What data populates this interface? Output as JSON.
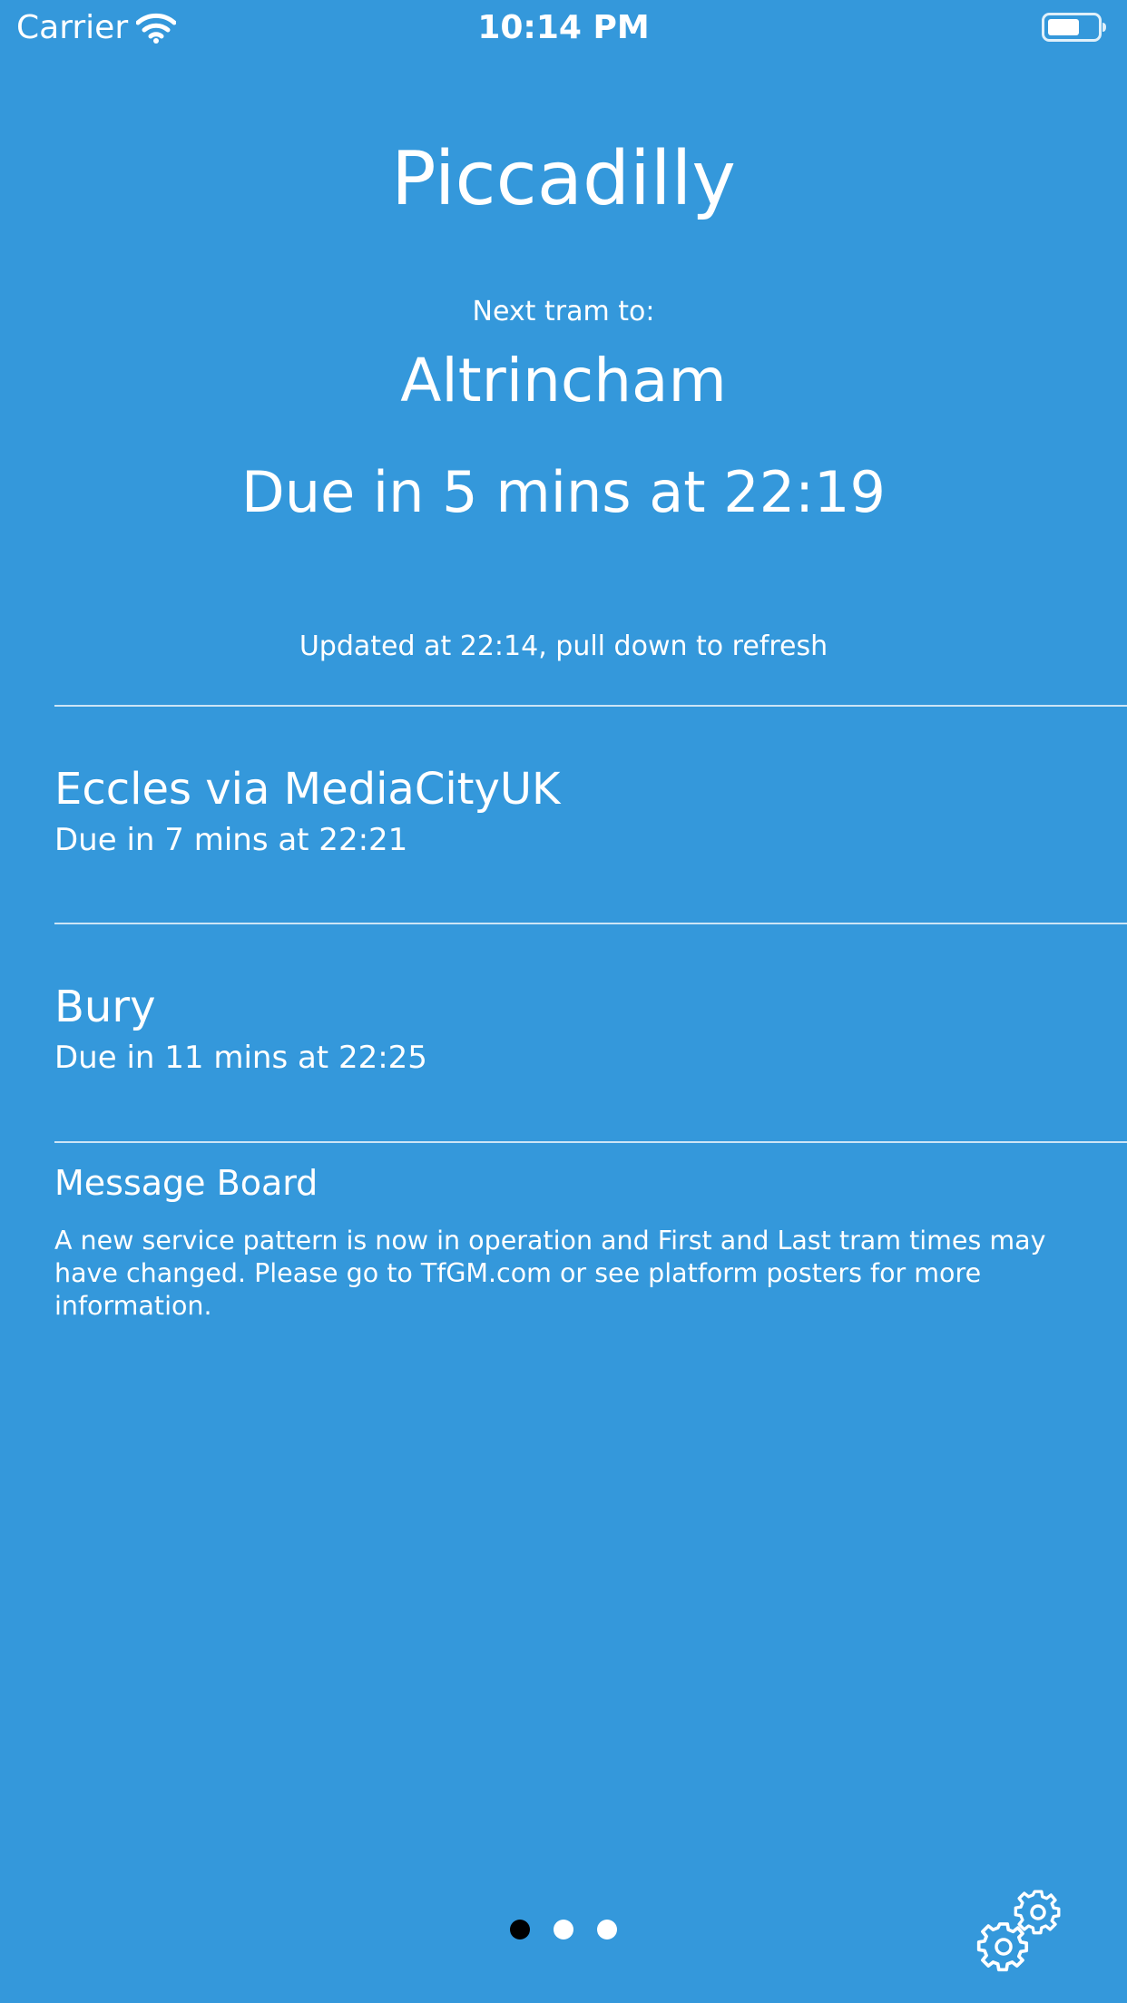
{
  "status_bar": {
    "carrier": "Carrier",
    "time": "10:14 PM",
    "wifi_icon": "wifi-icon",
    "battery_icon": "battery-icon"
  },
  "station": "Piccadilly",
  "next_tram": {
    "label": "Next tram to:",
    "destination": "Altrincham",
    "due": "Due in 5 mins at 22:19"
  },
  "updated": "Updated at 22:14, pull down to refresh",
  "trams": [
    {
      "destination": "Eccles via MediaCityUK",
      "due": "Due in 7 mins at 22:21"
    },
    {
      "destination": "Bury",
      "due": "Due in 11 mins at 22:25"
    }
  ],
  "message_board": {
    "title": "Message Board",
    "text": "A new service pattern is now in operation and First and Last tram times may have changed. Please go to TfGM.com or see platform posters for more information."
  },
  "pager": {
    "pages": 3,
    "current_page": 1
  },
  "settings_icon": "settings-gears-icon",
  "colors": {
    "background": "#3498db",
    "text": "#ffffff",
    "active_dot": "#000000"
  }
}
